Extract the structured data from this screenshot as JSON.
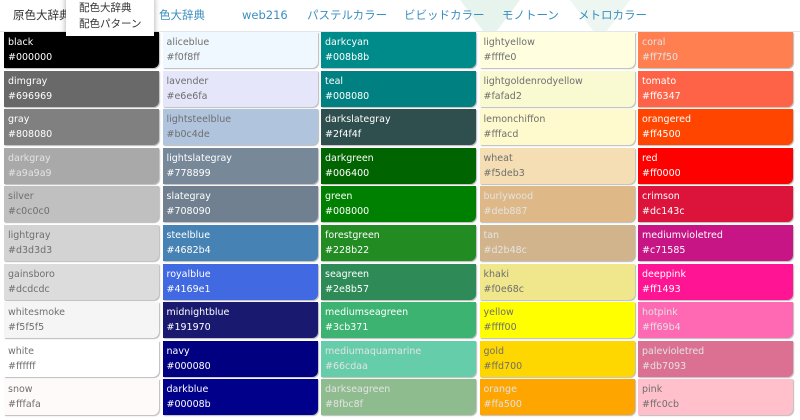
{
  "tabs": [
    {
      "label": "原色大辞典",
      "active": true
    },
    {
      "label": "色大辞典",
      "active": false
    },
    {
      "label": "web216",
      "active": false
    },
    {
      "label": "パステルカラー",
      "active": false
    },
    {
      "label": "ビビッドカラー",
      "active": false
    },
    {
      "label": "モノトーン",
      "active": false
    },
    {
      "label": "メトロカラー",
      "active": false
    }
  ],
  "dropdown": {
    "items": [
      "配色大辞典",
      "配色パターン"
    ]
  },
  "colors": [
    {
      "name": "black",
      "hex": "#000000",
      "fill": "#000000"
    },
    {
      "name": "aliceblue",
      "hex": "#f0f8ff",
      "fill": "#f0f8ff"
    },
    {
      "name": "darkcyan",
      "hex": "#008b8b",
      "fill": "#008b8b"
    },
    {
      "name": "lightyellow",
      "hex": "#ffffe0",
      "fill": "#ffffe0"
    },
    {
      "name": "coral",
      "hex": "#ff7f50",
      "fill": "#ff7f50"
    },
    {
      "name": "dimgray",
      "hex": "#696969",
      "fill": "#696969"
    },
    {
      "name": "lavender",
      "hex": "#e6e6fa",
      "fill": "#e6e6fa"
    },
    {
      "name": "teal",
      "hex": "#008080",
      "fill": "#008080"
    },
    {
      "name": "lightgoldenrodyellow",
      "hex": "#fafad2",
      "fill": "#fafad2"
    },
    {
      "name": "tomato",
      "hex": "#ff6347",
      "fill": "#ff6347"
    },
    {
      "name": "gray",
      "hex": "#808080",
      "fill": "#808080"
    },
    {
      "name": "lightsteelblue",
      "hex": "#b0c4de",
      "fill": "#b0c4de"
    },
    {
      "name": "darkslategray",
      "hex": "#2f4f4f",
      "fill": "#2f4f4f"
    },
    {
      "name": "lemonchiffon",
      "hex": "#fffacd",
      "fill": "#fffacd"
    },
    {
      "name": "orangered",
      "hex": "#ff4500",
      "fill": "#ff4500"
    },
    {
      "name": "darkgray",
      "hex": "#a9a9a9",
      "fill": "#a9a9a9"
    },
    {
      "name": "lightslategray",
      "hex": "#778899",
      "fill": "#778899"
    },
    {
      "name": "darkgreen",
      "hex": "#006400",
      "fill": "#006400"
    },
    {
      "name": "wheat",
      "hex": "#f5deb3",
      "fill": "#f5deb3"
    },
    {
      "name": "red",
      "hex": "#ff0000",
      "fill": "#ff0000"
    },
    {
      "name": "silver",
      "hex": "#c0c0c0",
      "fill": "#c0c0c0"
    },
    {
      "name": "slategray",
      "hex": "#708090",
      "fill": "#708090"
    },
    {
      "name": "green",
      "hex": "#008000",
      "fill": "#008000"
    },
    {
      "name": "burlywood",
      "hex": "#deb887",
      "fill": "#deb887"
    },
    {
      "name": "crimson",
      "hex": "#dc143c",
      "fill": "#dc143c"
    },
    {
      "name": "lightgray",
      "hex": "#d3d3d3",
      "fill": "#d3d3d3"
    },
    {
      "name": "steelblue",
      "hex": "#4682b4",
      "fill": "#4682b4"
    },
    {
      "name": "forestgreen",
      "hex": "#228b22",
      "fill": "#228b22"
    },
    {
      "name": "tan",
      "hex": "#d2b48c",
      "fill": "#d2b48c"
    },
    {
      "name": "mediumvioletred",
      "hex": "#c71585",
      "fill": "#c71585"
    },
    {
      "name": "gainsboro",
      "hex": "#dcdcdc",
      "fill": "#dcdcdc"
    },
    {
      "name": "royalblue",
      "hex": "#4169e1",
      "fill": "#4169e1"
    },
    {
      "name": "seagreen",
      "hex": "#2e8b57",
      "fill": "#2e8b57"
    },
    {
      "name": "khaki",
      "hex": "#f0e68c",
      "fill": "#f0e68c"
    },
    {
      "name": "deeppink",
      "hex": "#ff1493",
      "fill": "#ff1493"
    },
    {
      "name": "whitesmoke",
      "hex": "#f5f5f5",
      "fill": "#f5f5f5"
    },
    {
      "name": "midnightblue",
      "hex": "#191970",
      "fill": "#191970"
    },
    {
      "name": "mediumseagreen",
      "hex": "#3cb371",
      "fill": "#3cb371"
    },
    {
      "name": "yellow",
      "hex": "#ffff00",
      "fill": "#ffff00"
    },
    {
      "name": "hotpink",
      "hex": "#ff69b4",
      "fill": "#ff69b4"
    },
    {
      "name": "white",
      "hex": "#ffffff",
      "fill": "#ffffff"
    },
    {
      "name": "navy",
      "hex": "#000080",
      "fill": "#000080"
    },
    {
      "name": "mediumaquamarine",
      "hex": "#66cdaa",
      "fill": "#66cdaa"
    },
    {
      "name": "gold",
      "hex": "#ffd700",
      "fill": "#ffd700"
    },
    {
      "name": "palevioletred",
      "hex": "#db7093",
      "fill": "#db7093"
    },
    {
      "name": "snow",
      "hex": "#fffafa",
      "fill": "#fffafa"
    },
    {
      "name": "darkblue",
      "hex": "#00008b",
      "fill": "#00008b"
    },
    {
      "name": "darkseagreen",
      "hex": "#8fbc8f",
      "fill": "#8fbc8f"
    },
    {
      "name": "orange",
      "hex": "#ffa500",
      "fill": "#ffa500"
    },
    {
      "name": "pink",
      "hex": "#ffc0cb",
      "fill": "#ffc0cb"
    }
  ]
}
